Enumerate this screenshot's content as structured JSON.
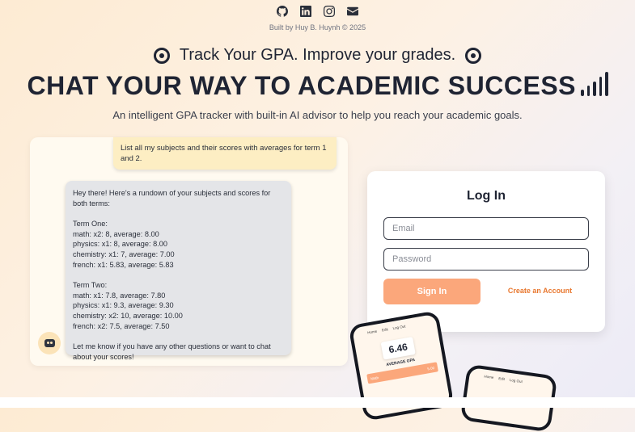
{
  "social": {
    "icons": [
      "github-icon",
      "linkedin-icon",
      "instagram-icon",
      "mail-icon"
    ]
  },
  "built_by": "Built by Huy B. Huynh © 2025",
  "tagline": "Track Your GPA. Improve your grades.",
  "headline": "CHAT YOUR WAY TO ACADEMIC SUCCESS",
  "subheadline": "An intelligent GPA tracker with built-in AI advisor to help you reach your academic goals.",
  "chat": {
    "user_message": "List all my subjects and their scores with averages for term 1 and 2.",
    "bot_intro": "Hey there! Here's a rundown of your subjects and scores for both terms:",
    "term_one_title": "Term One:",
    "term_one": [
      "math: x2: 8, average: 8.00",
      "physics: x1: 8, average: 8.00",
      "chemistry: x1: 7, average: 7.00",
      "french: x1: 5.83, average: 5.83"
    ],
    "term_two_title": "Term Two:",
    "term_two": [
      "math: x1: 7.8, average: 7.80",
      "physics: x1: 9.3, average: 9.30",
      "chemistry: x2: 10, average: 10.00",
      "french: x2: 7.5, average: 7.50"
    ],
    "bot_outro": "Let me know if you have any other questions or want to chat about your scores!"
  },
  "login": {
    "title": "Log In",
    "email_placeholder": "Email",
    "password_placeholder": "Password",
    "sign_in_label": "Sign In",
    "create_account_label": "Create an Account"
  },
  "phone": {
    "nav": [
      "Home",
      "Edit",
      "Log Out"
    ],
    "gpa_value": "6.46",
    "gpa_label": "AVERAGE GPA",
    "row_subject": "Math",
    "row_value": "5.00"
  },
  "colors": {
    "accent": "#fba77b",
    "link": "#e8772e",
    "user_bubble": "#fdeec3",
    "bot_bubble": "#e4e5e8"
  }
}
